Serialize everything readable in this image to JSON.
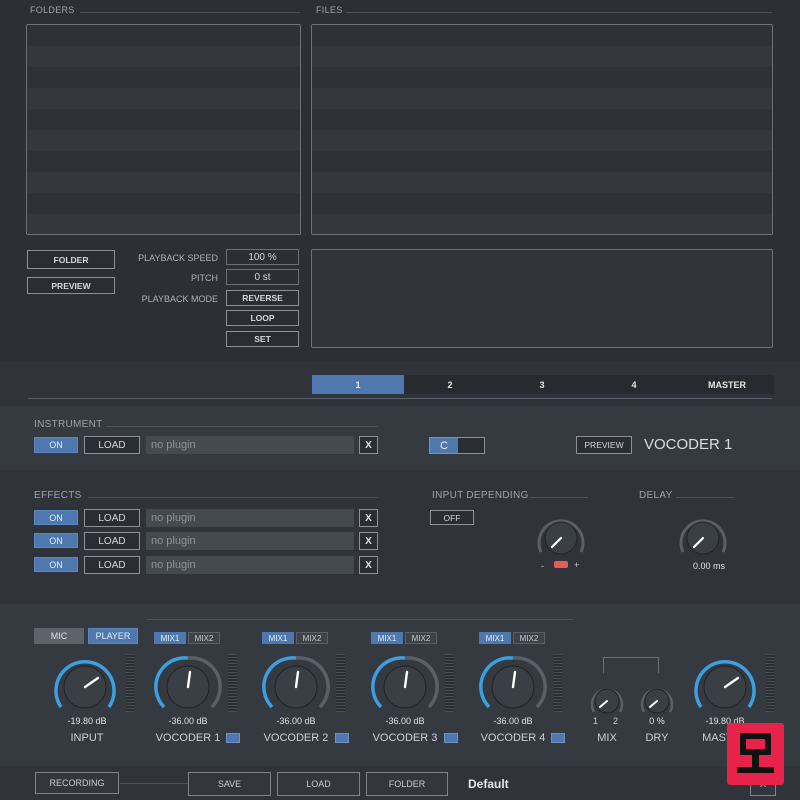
{
  "browser": {
    "folders_label": "FOLDERS",
    "files_label": "FILES"
  },
  "controls": {
    "folder_button": "FOLDER",
    "preview_button": "PREVIEW",
    "playback_speed_label": "PLAYBACK SPEED",
    "playback_speed_value": "100 %",
    "pitch_label": "PITCH",
    "pitch_value": "0 st",
    "playback_mode_label": "PLAYBACK  MODE",
    "reverse_button": "REVERSE",
    "loop_button": "LOOP",
    "set_button": "SET"
  },
  "tabs": [
    {
      "label": "1",
      "active": true
    },
    {
      "label": "2",
      "active": false
    },
    {
      "label": "3",
      "active": false
    },
    {
      "label": "4",
      "active": false
    },
    {
      "label": "MASTER",
      "active": false
    }
  ],
  "instrument": {
    "section_label": "INSTRUMENT",
    "on_label": "ON",
    "load_label": "LOAD",
    "plugin": "no plugin",
    "x_label": "X",
    "key": "C",
    "preview_label": "PREVIEW",
    "vocoder_title": "VOCODER 1"
  },
  "effects": {
    "section_label": "EFFECTS",
    "rows": [
      {
        "on": "ON",
        "load": "LOAD",
        "plugin": "no plugin",
        "x": "X"
      },
      {
        "on": "ON",
        "load": "LOAD",
        "plugin": "no plugin",
        "x": "X"
      },
      {
        "on": "ON",
        "load": "LOAD",
        "plugin": "no plugin",
        "x": "X"
      }
    ]
  },
  "input_depending": {
    "label": "INPUT DEPENDING",
    "off_label": "OFF",
    "minus": "-",
    "plus": "+"
  },
  "delay": {
    "label": "DELAY",
    "value": "0.00 ms"
  },
  "mixer": {
    "mic_label": "MIC",
    "player_label": "PLAYER",
    "mix1": "MIX1",
    "mix2": "MIX2",
    "channels": [
      {
        "name": "INPUT",
        "value": "-19.80 dB"
      },
      {
        "name": "VOCODER 1",
        "value": "-36.00 dB"
      },
      {
        "name": "VOCODER 2",
        "value": "-36.00 dB"
      },
      {
        "name": "VOCODER 3",
        "value": "-36.00 dB"
      },
      {
        "name": "VOCODER 4",
        "value": "-36.00 dB"
      }
    ],
    "mix": {
      "name": "MIX",
      "left": "1",
      "right": "2"
    },
    "dry": {
      "name": "DRY",
      "value": "0 %"
    },
    "master": {
      "name": "MASTER",
      "value": "-19.80 dB"
    }
  },
  "bottom": {
    "recording": "RECORDING",
    "save": "SAVE",
    "load": "LOAD",
    "folder": "FOLDER",
    "preset": "Default",
    "right_button": "A"
  },
  "colors": {
    "accent_blue": "#4e78ae",
    "knob_arc": "#3d9ee0",
    "background": "#2c3036",
    "red_indicator": "#e45b5b"
  }
}
